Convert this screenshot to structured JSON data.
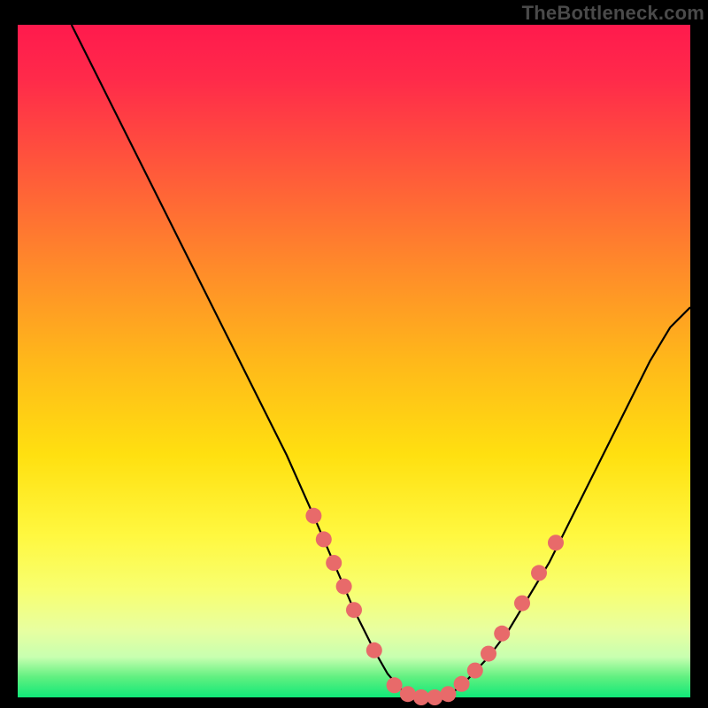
{
  "watermark": {
    "text": "TheBottleneck.com"
  },
  "chart_data": {
    "type": "line",
    "title": "",
    "xlabel": "",
    "ylabel": "",
    "xlim": [
      0,
      100
    ],
    "ylim": [
      0,
      100
    ],
    "series": [
      {
        "name": "curve",
        "x": [
          8,
          12,
          16,
          20,
          24,
          28,
          32,
          36,
          40,
          44,
          47,
          50,
          53,
          55,
          57,
          59,
          61,
          63,
          65,
          67,
          70,
          73,
          76,
          79,
          82,
          85,
          88,
          91,
          94,
          97,
          100
        ],
        "values": [
          100,
          92,
          84,
          76,
          68,
          60,
          52,
          44,
          36,
          27,
          20,
          13,
          7,
          3.5,
          1.2,
          0.2,
          0.0,
          0.2,
          1.0,
          2.8,
          6,
          10,
          15,
          20,
          26,
          32,
          38,
          44,
          50,
          55,
          58
        ],
        "color": "#000000"
      }
    ],
    "markers": [
      {
        "name": "dots",
        "color": "#e86a6a",
        "points": [
          {
            "x": 44.0,
            "y": 27.0
          },
          {
            "x": 45.5,
            "y": 23.5
          },
          {
            "x": 47.0,
            "y": 20.0
          },
          {
            "x": 48.5,
            "y": 16.5
          },
          {
            "x": 50.0,
            "y": 13.0
          },
          {
            "x": 53.0,
            "y": 7.0
          },
          {
            "x": 56.0,
            "y": 1.8
          },
          {
            "x": 58.0,
            "y": 0.5
          },
          {
            "x": 60.0,
            "y": 0.0
          },
          {
            "x": 62.0,
            "y": 0.0
          },
          {
            "x": 64.0,
            "y": 0.5
          },
          {
            "x": 66.0,
            "y": 2.0
          },
          {
            "x": 68.0,
            "y": 4.0
          },
          {
            "x": 70.0,
            "y": 6.5
          },
          {
            "x": 72.0,
            "y": 9.5
          },
          {
            "x": 75.0,
            "y": 14.0
          },
          {
            "x": 77.5,
            "y": 18.5
          },
          {
            "x": 80.0,
            "y": 23.0
          }
        ]
      }
    ],
    "grid": false,
    "legend": false
  }
}
